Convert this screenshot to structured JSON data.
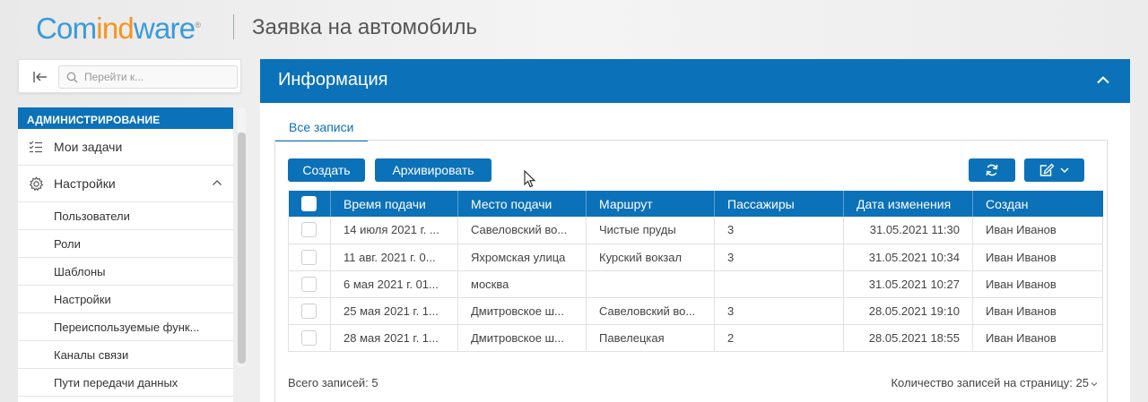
{
  "header": {
    "logo_part1": "Com",
    "logo_part2": "ind",
    "logo_part3": "ware",
    "logo_reg": "®",
    "title": "Заявка на автомобиль"
  },
  "search": {
    "placeholder": "Перейти к..."
  },
  "sidebar": {
    "section": "АДМИНИСТРИРОВАНИЕ",
    "items": [
      {
        "label": "Мои задачи",
        "icon": "task-list-icon"
      },
      {
        "label": "Настройки",
        "icon": "gear-icon",
        "expanded": true
      }
    ],
    "subitems": [
      "Пользователи",
      "Роли",
      "Шаблоны",
      "Настройки",
      "Переиспользуемые функ...",
      "Каналы связи",
      "Пути передачи данных"
    ]
  },
  "panel": {
    "title": "Информация",
    "tab": "Все записи",
    "create_label": "Создать",
    "archive_label": "Архивировать"
  },
  "table": {
    "columns": [
      "Время подачи",
      "Место подачи",
      "Маршрут",
      "Пассажиры",
      "Дата изменения",
      "Создан"
    ],
    "rows": [
      [
        "14 июля 2021 г. ...",
        "Савеловский во...",
        "Чистые пруды",
        "3",
        "31.05.2021 11:30",
        "Иван Иванов"
      ],
      [
        "11 авг. 2021 г. 0...",
        "Яхромская улица",
        "Курский вокзал",
        "3",
        "31.05.2021 10:34",
        "Иван Иванов"
      ],
      [
        "6 мая 2021 г. 01...",
        "москва",
        "",
        "",
        "31.05.2021 10:27",
        "Иван Иванов"
      ],
      [
        "25 мая 2021 г. 1...",
        "Дмитровское ш...",
        "Савеловский во...",
        "3",
        "28.05.2021 19:10",
        "Иван Иванов"
      ],
      [
        "28 мая 2021 г. 1...",
        "Дмитровское ш...",
        "Павелецкая",
        "2",
        "28.05.2021 18:55",
        "Иван Иванов"
      ]
    ]
  },
  "footer": {
    "total": "Всего записей: 5",
    "per_page": "Количество записей на страницу: 25"
  },
  "colors": {
    "brand_blue": "#0b71b9",
    "logo_orange": "#f7941d",
    "logo_blue": "#3a9ad9"
  }
}
